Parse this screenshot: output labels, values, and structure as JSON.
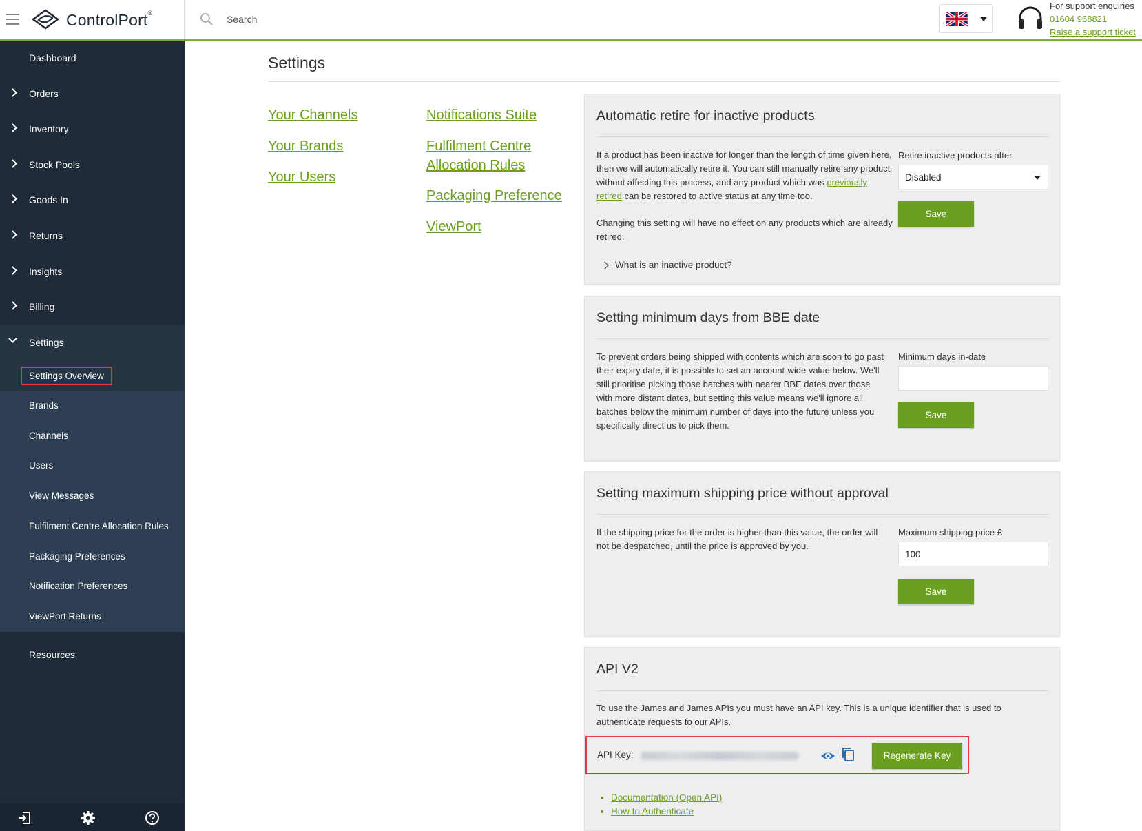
{
  "header": {
    "brand_name": "ControlPort",
    "brand_mark": "®",
    "search_placeholder": "Search",
    "support_title": "For support enquiries",
    "support_phone": "01604 968821",
    "support_ticket": "Raise a support ticket",
    "accent_color": "#7cb342"
  },
  "sidebar": {
    "items": [
      {
        "label": "Dashboard"
      },
      {
        "label": "Orders"
      },
      {
        "label": "Inventory"
      },
      {
        "label": "Stock Pools"
      },
      {
        "label": "Goods In"
      },
      {
        "label": "Returns"
      },
      {
        "label": "Insights"
      },
      {
        "label": "Billing"
      },
      {
        "label": "Settings"
      },
      {
        "label": "Resources"
      }
    ],
    "settings_submenu": [
      {
        "label": "Settings Overview"
      },
      {
        "label": "Brands"
      },
      {
        "label": "Channels"
      },
      {
        "label": "Users"
      },
      {
        "label": "View Messages"
      },
      {
        "label": "Fulfilment Centre Allocation Rules"
      },
      {
        "label": "Packaging Preferences"
      },
      {
        "label": "Notification Preferences"
      },
      {
        "label": "ViewPort Returns"
      }
    ],
    "bottom_icons": [
      "logout-icon",
      "gear-icon",
      "help-icon"
    ]
  },
  "main": {
    "title": "Settings",
    "links_col1": [
      "Your Channels",
      "Your Brands",
      "Your Users"
    ],
    "links_col2": [
      "Notifications Suite",
      "Fulfilment Centre",
      "Allocation Rules",
      "Packaging Preference",
      "ViewPort"
    ]
  },
  "cards": {
    "retire": {
      "title": "Automatic retire for inactive products",
      "text_1a": "If a product has been inactive for longer than the length of time given here, then we will automatically retire it. You can still manually retire any product without affecting this process, and any product which was ",
      "text_1_link": "previously retired",
      "text_1b": " can be restored to active status at any time too.",
      "text_2": "Changing this setting will have no effect on any products which are already retired.",
      "field_label": "Retire inactive products after",
      "field_value": "Disabled",
      "save": "Save",
      "expander": "What is an inactive product?"
    },
    "bbe": {
      "title": "Setting minimum days from BBE date",
      "text": "To prevent orders being shipped with contents which are soon to go past their expiry date, it is possible to set an account-wide value below. We'll still prioritise picking those batches with nearer BBE dates over those with more distant dates, but setting this value means we'll ignore all batches below the minimum number of days into the future unless you specifically direct us to pick them.",
      "field_label": "Minimum days in-date",
      "field_value": "",
      "save": "Save"
    },
    "shipping": {
      "title": "Setting maximum shipping price without approval",
      "text": "If the shipping price for the order is higher than this value, the order will not be despatched, until the price is approved by you.",
      "field_label": "Maximum shipping price £",
      "field_value": "100",
      "save": "Save"
    },
    "api": {
      "title": "API V2",
      "text": "To use the James and James APIs you must have an API key. This is a unique identifier that is used to authenticate requests to our APIs.",
      "key_label": "API Key:",
      "regen": "Regenerate Key",
      "docs": [
        "Documentation (Open API)",
        "How to Authenticate"
      ]
    }
  }
}
